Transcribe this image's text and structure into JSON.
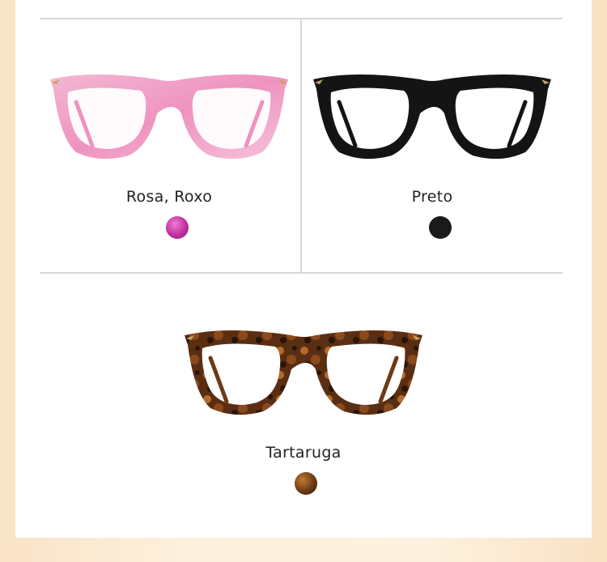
{
  "variants": [
    {
      "name": "Rosa, Roxo",
      "frame_color": "#f0a2c6",
      "swatch_color": "#c02fa0"
    },
    {
      "name": "Preto",
      "frame_color": "#141414",
      "swatch_color": "#1a1a1a"
    },
    {
      "name": "Tartaruga",
      "frame_color": "#5a2e12",
      "swatch_color": "#6b3a16"
    }
  ]
}
